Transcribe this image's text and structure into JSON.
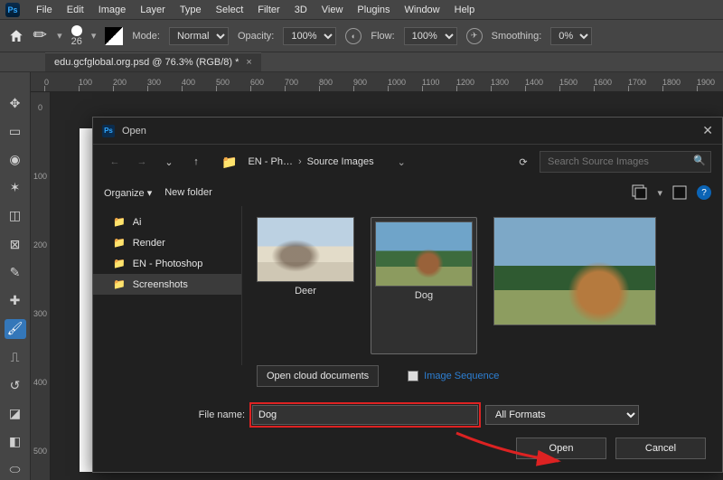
{
  "menubar": {
    "items": [
      "File",
      "Edit",
      "Image",
      "Layer",
      "Type",
      "Select",
      "Filter",
      "3D",
      "View",
      "Plugins",
      "Window",
      "Help"
    ]
  },
  "optionsbar": {
    "brush_size": "26",
    "mode_label": "Mode:",
    "mode_value": "Normal",
    "opacity_label": "Opacity:",
    "opacity_value": "100%",
    "flow_label": "Flow:",
    "flow_value": "100%",
    "smoothing_label": "Smoothing:",
    "smoothing_value": "0%"
  },
  "tab": {
    "title": "edu.gcfglobal.org.psd @ 76.3% (RGB/8) *"
  },
  "ruler": {
    "h": [
      "0",
      "100",
      "200",
      "300",
      "400",
      "500",
      "600",
      "700",
      "800",
      "900",
      "1000",
      "1100",
      "1200",
      "1300",
      "1400",
      "1500",
      "1600",
      "1700",
      "1800",
      "1900"
    ],
    "v": [
      "0",
      "100",
      "200",
      "300",
      "400",
      "500"
    ]
  },
  "dialog": {
    "title": "Open",
    "breadcrumb": {
      "seg1": "EN - Ph…",
      "seg2": "Source Images"
    },
    "refresh_tooltip": "Refresh",
    "search_placeholder": "Search Source Images",
    "organize": "Organize",
    "new_folder": "New folder",
    "folders": [
      {
        "label": "Ai"
      },
      {
        "label": "Render"
      },
      {
        "label": "EN - Photoshop"
      },
      {
        "label": "Screenshots"
      }
    ],
    "thumbs": {
      "deer": "Deer",
      "dog": "Dog"
    },
    "cloud_btn": "Open cloud documents",
    "image_sequence": "Image Sequence",
    "file_name_label": "File name:",
    "file_name_value": "Dog",
    "format_value": "All Formats",
    "open_btn": "Open",
    "cancel_btn": "Cancel"
  }
}
